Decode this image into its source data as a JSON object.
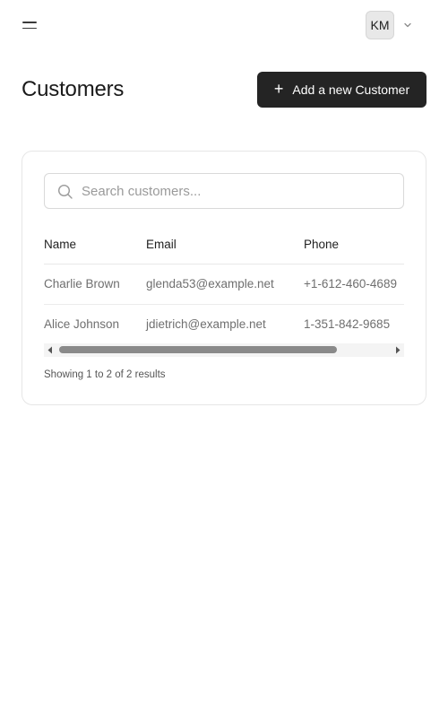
{
  "header": {
    "user_initials": "KM"
  },
  "page": {
    "title": "Customers",
    "add_button_label": "Add a new Customer"
  },
  "search": {
    "placeholder": "Search customers...",
    "value": ""
  },
  "table": {
    "columns": [
      "Name",
      "Email",
      "Phone"
    ],
    "rows": [
      [
        "Charlie Brown",
        "glenda53@example.net",
        "+1-612-460-4689"
      ],
      [
        "Alice Johnson",
        "jdietrich@example.net",
        "1-351-842-9685"
      ]
    ]
  },
  "pagination": {
    "summary": "Showing 1 to 2 of 2 results"
  },
  "colors": {
    "primary_button": "#242424",
    "border": "#e6e6e6",
    "muted_text": "#6f6f6f"
  }
}
